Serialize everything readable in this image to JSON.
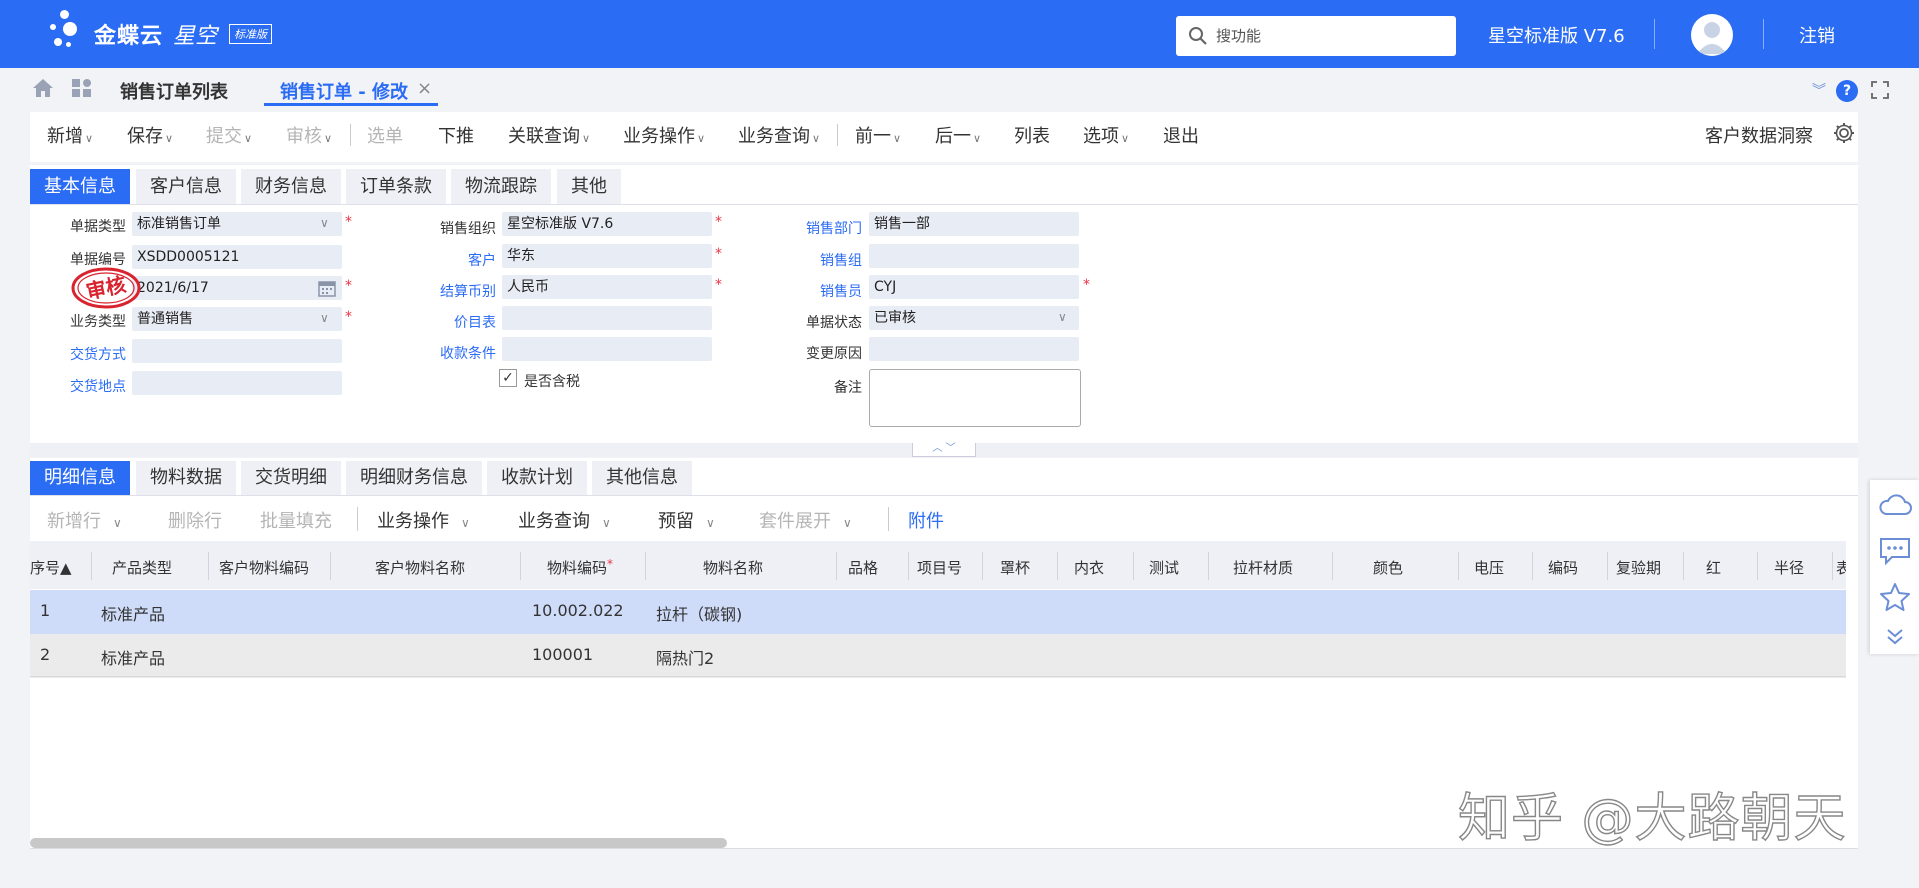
{
  "header": {
    "brand": "金蝶云",
    "brand_sub": "星空",
    "edition_badge": "标准版",
    "search_placeholder": "搜功能",
    "version": "星空标准版 V7.6",
    "logout": "注销"
  },
  "page_tabs": {
    "list": "销售订单列表",
    "edit": "销售订单 - 修改",
    "close": "×"
  },
  "toolbar": {
    "items": [
      "新增",
      "保存",
      "提交",
      "审核",
      "选单",
      "下推",
      "关联查询",
      "业务操作",
      "业务查询",
      "前一",
      "后一",
      "列表",
      "选项",
      "退出"
    ],
    "right": "客户数据洞察"
  },
  "form_tabs": [
    "基本信息",
    "客户信息",
    "财务信息",
    "订单条款",
    "物流跟踪",
    "其他"
  ],
  "form": {
    "bill_type_label": "单据类型",
    "bill_type": "标准销售订单",
    "bill_no_label": "单据编号",
    "bill_no": "XSDD0005121",
    "date": "2021/6/17",
    "biz_type_label": "业务类型",
    "biz_type": "普通销售",
    "delivery_method_label": "交货方式",
    "delivery_place_label": "交货地点",
    "sale_org_label": "销售组织",
    "sale_org": "星空标准版 V7.6",
    "customer_label": "客户",
    "customer": "华东",
    "currency_label": "结算币别",
    "currency": "人民币",
    "price_list_label": "价目表",
    "payment_terms_label": "收款条件",
    "tax_included_label": "是否含税",
    "tax_included_check": "✓",
    "sale_dept_label": "销售部门",
    "sale_dept": "销售一部",
    "sale_group_label": "销售组",
    "salesman_label": "销售员",
    "salesman": "CYJ",
    "bill_status_label": "单据状态",
    "bill_status": "已审核",
    "change_reason_label": "变更原因",
    "remark_label": "备注",
    "stamp": "审核",
    "required_mark": "*"
  },
  "detail_tabs": [
    "明细信息",
    "物料数据",
    "交货明细",
    "明细财务信息",
    "收款计划",
    "其他信息"
  ],
  "grid_toolbar": [
    "新增行",
    "删除行",
    "批量填充",
    "业务操作",
    "业务查询",
    "预留",
    "套件展开",
    "附件"
  ],
  "grid": {
    "columns": [
      "序号▲",
      "产品类型",
      "客户物料编码",
      "客户物料名称",
      "物料编码",
      "物料名称",
      "品格",
      "项目号",
      "罩杯",
      "内衣",
      "测试",
      "拉杆材质",
      "颜色",
      "电压",
      "编码",
      "复验期",
      "红",
      "半径",
      "表"
    ],
    "rows": [
      [
        "1",
        "标准产品",
        "",
        "",
        "10.002.022",
        "拉杆（碳钢)"
      ],
      [
        "2",
        "标准产品",
        "",
        "",
        "100001",
        "隔热门2"
      ]
    ]
  },
  "watermark": "知乎 @大路朝天",
  "colors": {
    "primary": "#2b6cf4",
    "required": "#e34444",
    "stamp": "#d9232e"
  }
}
